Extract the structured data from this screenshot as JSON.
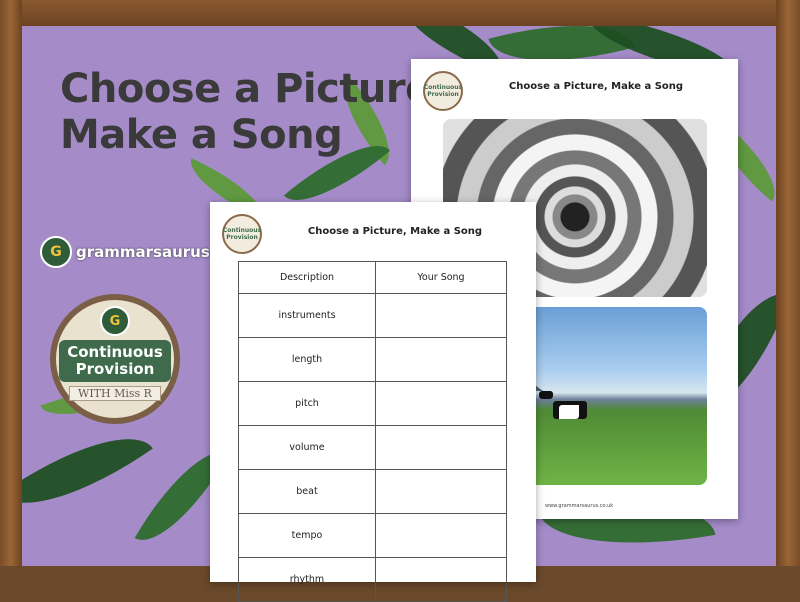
{
  "page": {
    "title_line1": "Choose a Picture,",
    "title_line2": "Make a Song"
  },
  "brand": {
    "site": "grammarsaurus.co.uk",
    "badge_letter": "G",
    "badge_title": "Continuous Provision",
    "badge_subtitle": "WITH Miss R"
  },
  "worksheet_back": {
    "logo_text": "Continuous Provision",
    "heading": "Choose a Picture, Make a Song",
    "footer": "www.grammarsaurus.co.uk"
  },
  "worksheet_front": {
    "logo_text": "Continuous Provision",
    "heading": "Choose a Picture, Make a Song",
    "table": {
      "headers": [
        "Description",
        "Your Song"
      ],
      "rows": [
        "instruments",
        "length",
        "pitch",
        "volume",
        "beat",
        "tempo",
        "rhythm"
      ]
    }
  }
}
